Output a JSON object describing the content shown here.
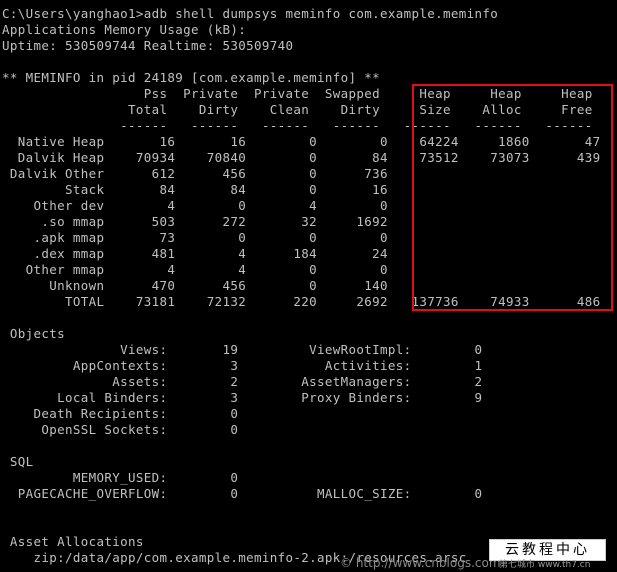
{
  "terminal": {
    "lines": [
      "C:\\Users\\yanghao1>adb shell dumpsys meminfo com.example.meminfo",
      "Applications Memory Usage (kB):",
      "Uptime: 530509744 Realtime: 530509740",
      "",
      "** MEMINFO in pid 24189 [com.example.meminfo] **",
      "                  Pss  Private  Private  Swapped     Heap     Heap     Heap",
      "                Total    Dirty    Clean    Dirty     Size    Alloc     Free",
      "               ------   ------   ------   ------   ------   ------   ------",
      "  Native Heap       16       16        0        0    64224     1860       47",
      "  Dalvik Heap    70934    70840        0       84    73512    73073      439",
      " Dalvik Other      612      456        0      736",
      "        Stack       84       84        0       16",
      "    Other dev        4        0        4        0",
      "     .so mmap      503      272       32     1692",
      "    .apk mmap       73        0        0        0",
      "    .dex mmap      481        4      184       24",
      "   Other mmap        4        4        0        0",
      "      Unknown      470      456        0      140",
      "        TOTAL    73181    72132      220     2692   137736    74933      486",
      "",
      " Objects",
      "               Views:       19         ViewRootImpl:        0",
      "         AppContexts:        3           Activities:        1",
      "              Assets:        2        AssetManagers:        2",
      "       Local Binders:        3        Proxy Binders:        9",
      "    Death Recipients:        0",
      "     OpenSSL Sockets:        0",
      "",
      " SQL",
      "         MEMORY_USED:        0",
      "  PAGECACHE_OVERFLOW:        0          MALLOC_SIZE:        0",
      "",
      "",
      " Asset Allocations",
      "    zip:/data/app/com.example.meminfo-2.apk:/resources.arsc"
    ]
  },
  "watermark": {
    "site_label": "云教程中心",
    "url": "© http://www.cnblogs.com",
    "corner": "第七城市 www.th7.cn"
  },
  "colors": {
    "background": "#000000",
    "text": "#c0c0c0",
    "highlight_border": "#e01010"
  }
}
